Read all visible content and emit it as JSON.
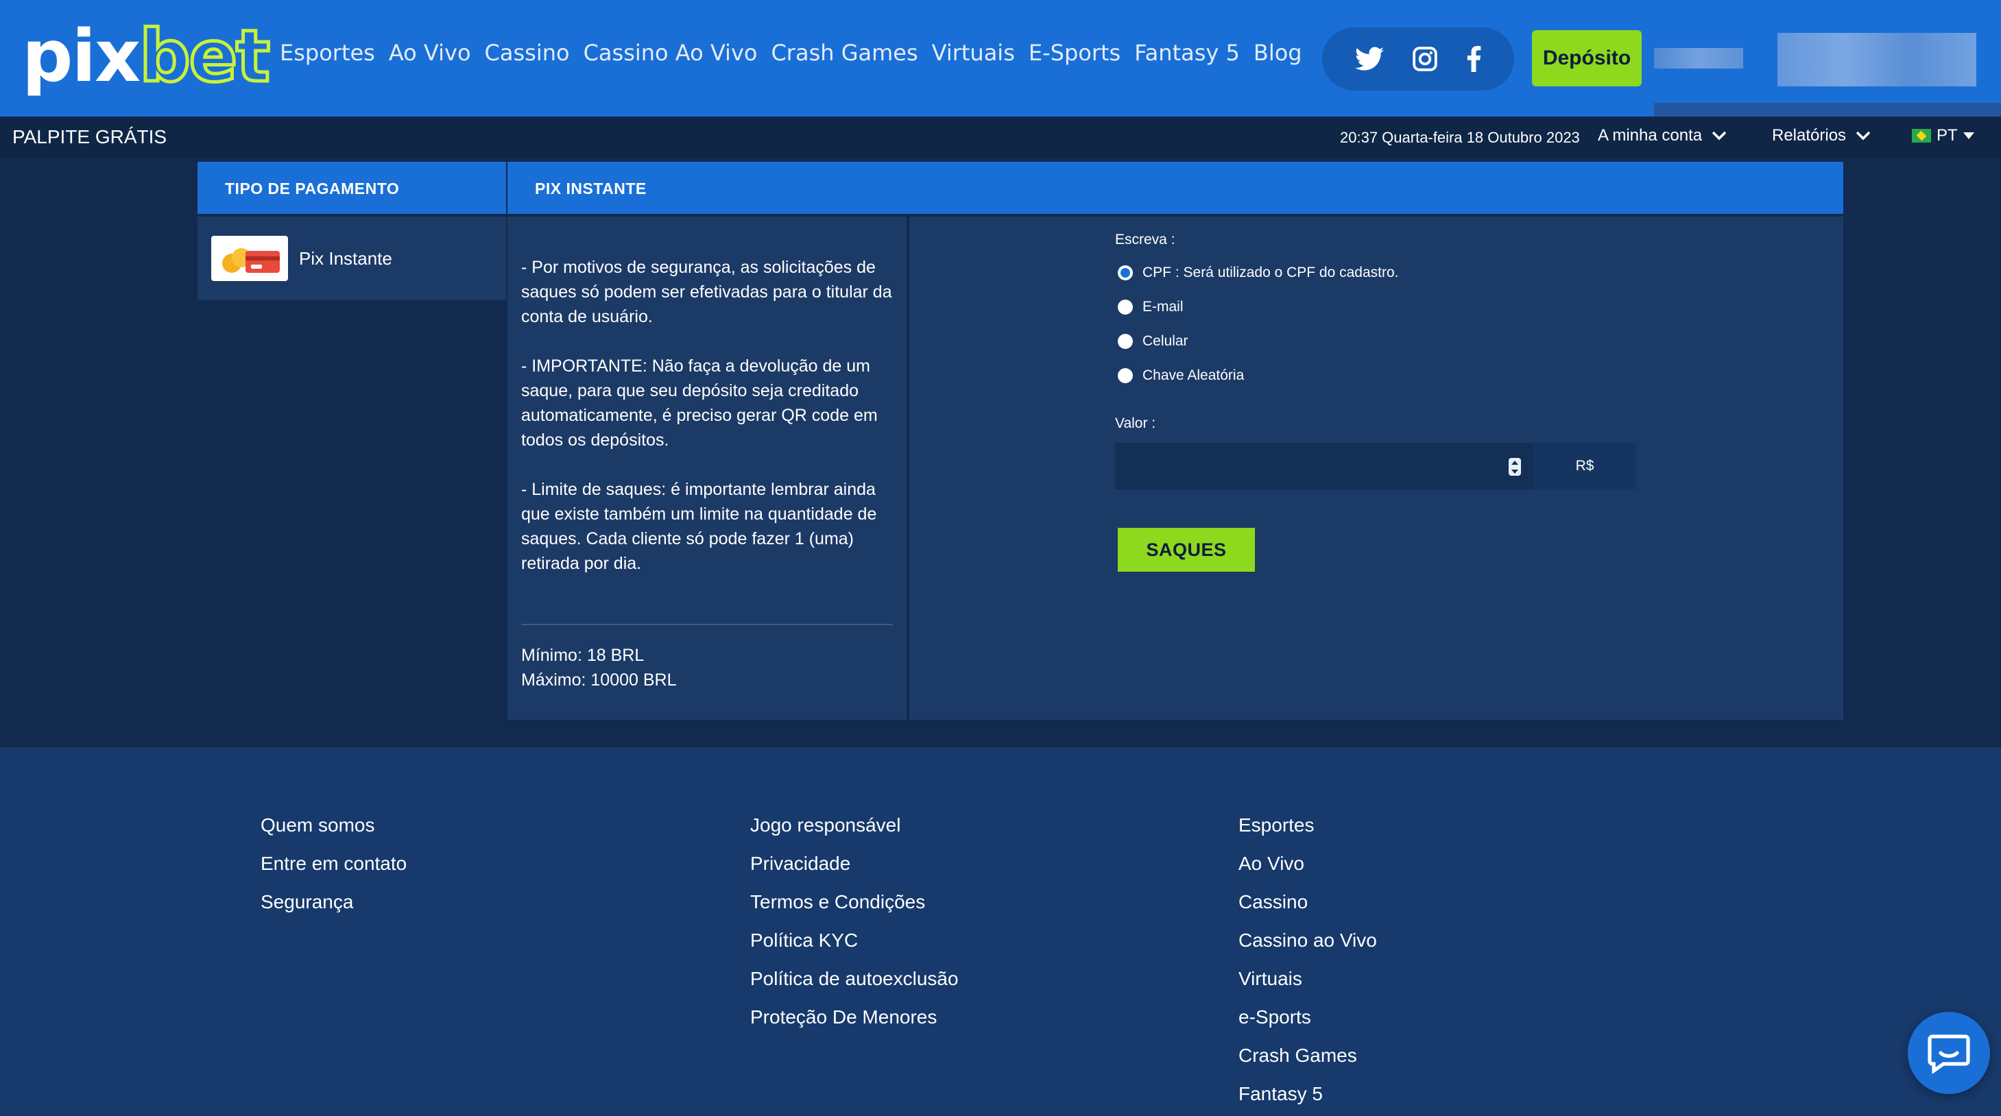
{
  "brand": {
    "logo_part1": "pix",
    "logo_part2": "bet"
  },
  "nav": [
    "Esportes",
    "Ao Vivo",
    "Cassino",
    "Cassino Ao Vivo",
    "Crash Games",
    "Virtuais",
    "E-Sports",
    "Fantasy 5",
    "Blog"
  ],
  "social_icons": [
    "twitter-icon",
    "instagram-icon",
    "facebook-icon"
  ],
  "header": {
    "deposit_label": "Depósito"
  },
  "subbar": {
    "palpite": "PALPITE GRÁTIS",
    "datetime": "20:37 Quarta-feira 18 Outubro 2023",
    "account": "A minha conta",
    "reports": "Relatórios",
    "language": "PT"
  },
  "payment": {
    "type_header": "TIPO DE PAGAMENTO",
    "method_header": "PIX INSTANTE",
    "method_label": "Pix Instante",
    "info": [
      "- Por motivos de segurança, as solicitações de saques só podem ser efetivadas para o titular da conta de usuário.",
      "- IMPORTANTE: Não faça a devolução de um saque, para que seu depósito seja creditado automaticamente, é preciso gerar QR code em todos os depósitos.",
      "- Limite de saques: é importante lembrar ainda que existe também um limite na quantidade de saques. Cada cliente só pode fazer 1 (uma) retirada por dia."
    ],
    "minimum": "Mínimo: 18 BRL",
    "maximum": "Máximo: 10000 BRL"
  },
  "form": {
    "escreva_label": "Escreva :",
    "options": [
      {
        "label": "CPF : Será utilizado o CPF do cadastro.",
        "checked": true
      },
      {
        "label": "E-mail",
        "checked": false
      },
      {
        "label": "Celular",
        "checked": false
      },
      {
        "label": "Chave Aleatória",
        "checked": false
      }
    ],
    "valor_label": "Valor :",
    "valor_value": "",
    "currency": "R$",
    "submit_label": "SAQUES"
  },
  "footer": {
    "col1": [
      "Quem somos",
      "Entre em contato",
      "Segurança"
    ],
    "col2": [
      "Jogo responsável",
      "Privacidade",
      "Termos e Condições",
      "Política KYC",
      "Política de autoexclusão",
      "Proteção De Menores"
    ],
    "col3": [
      "Esportes",
      "Ao Vivo",
      "Cassino",
      "Cassino ao Vivo",
      "Virtuais",
      "e-Sports",
      "Crash Games",
      "Fantasy 5"
    ]
  },
  "colors": {
    "primary": "#1a6fd6",
    "accent": "#8ed81e",
    "background": "#112a4d",
    "panel": "#1c3a66"
  }
}
